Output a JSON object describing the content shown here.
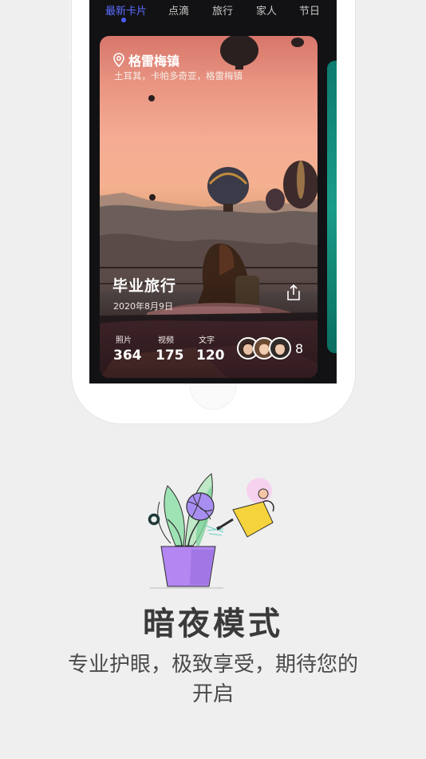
{
  "tabs": [
    {
      "label": "最新卡片",
      "active": true
    },
    {
      "label": "点滴",
      "active": false
    },
    {
      "label": "旅行",
      "active": false
    },
    {
      "label": "家人",
      "active": false
    },
    {
      "label": "节日",
      "active": false
    }
  ],
  "card": {
    "location_title": "格雷梅镇",
    "location_subtitle": "土耳其，卡帕多奇亚，格雷梅镇",
    "trip_title": "毕业旅行",
    "trip_date": "2020年8月9日",
    "stats": [
      {
        "label": "照片",
        "value": "364"
      },
      {
        "label": "视频",
        "value": "175"
      },
      {
        "label": "文字",
        "value": "120"
      }
    ],
    "member_count": "8"
  },
  "feature": {
    "headline": "暗夜模式",
    "description": "专业护眼，极致享受，期待您的开启"
  },
  "colors": {
    "accent": "#4b5cff",
    "background": "#efefef",
    "screen": "#121214",
    "pot": "#b084f0",
    "watering_can": "#f5d33c"
  },
  "icons": [
    "location-pin-icon",
    "share-icon",
    "avatar",
    "plant-illustration"
  ]
}
